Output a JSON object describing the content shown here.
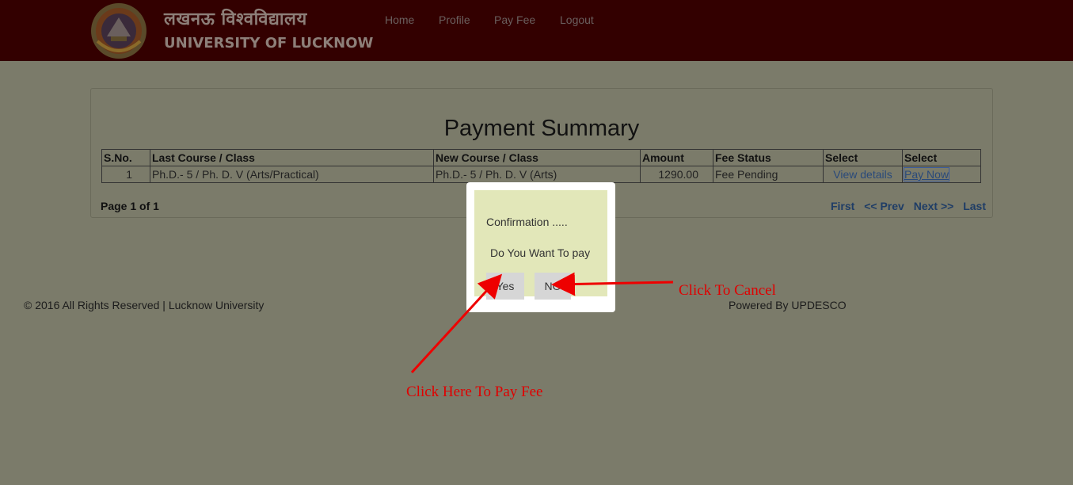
{
  "header": {
    "logo_hindi": "लखनऊ विश्वविद्यालय",
    "logo_english": "UNIVERSITY OF LUCKNOW",
    "nav": [
      "Home",
      "Profile",
      "Pay Fee",
      "Logout"
    ]
  },
  "summary": {
    "title": "Payment Summary",
    "columns": [
      "S.No.",
      "Last Course / Class",
      "New Course / Class",
      "Amount",
      "Fee Status",
      "Select",
      "Select"
    ],
    "rows": [
      {
        "sno": "1",
        "last_course": "Ph.D.- 5 / Ph. D. V (Arts/Practical)",
        "new_course": "Ph.D.- 5 / Ph. D. V (Arts)",
        "amount": "1290.00",
        "fee_status": "Fee Pending",
        "view_link": "View details",
        "pay_link": "Pay Now"
      }
    ],
    "page_info": "Page 1 of 1",
    "pager": {
      "first": "First",
      "prev": "<< Prev",
      "next": "Next >>",
      "last": "Last"
    }
  },
  "footer": {
    "left": "© 2016 All Rights Reserved | Lucknow University",
    "right": "Powered By UPDESCO"
  },
  "modal": {
    "title": "Confirmation .....",
    "message": "Do You Want To pay",
    "yes_label": "Yes",
    "no_label": "NO"
  },
  "annotations": {
    "cancel": "Click To Cancel",
    "pay": "Click Here To Pay Fee"
  },
  "colors": {
    "header_bg": "#330000",
    "overlay_bg": "#7b7b6a",
    "modal_bg": "#e2e7b9",
    "annotation": "#e00000"
  }
}
